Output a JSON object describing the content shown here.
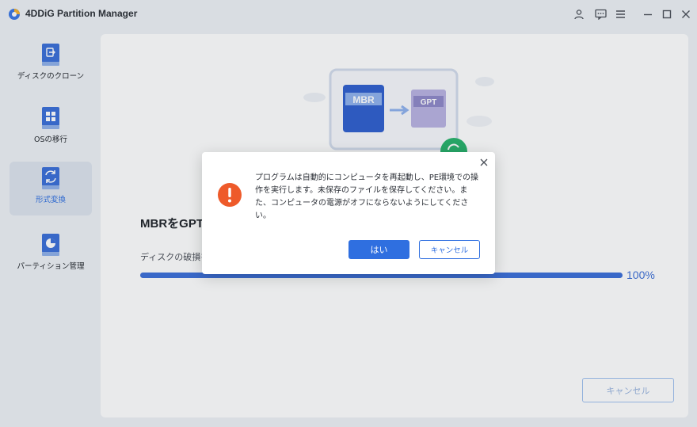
{
  "app": {
    "title": "4DDiG Partition Manager"
  },
  "sidebar": {
    "items": [
      {
        "label": "ディスクのクローン",
        "icon": "disk-clone-icon"
      },
      {
        "label": "OSの移行",
        "icon": "os-migrate-icon"
      },
      {
        "label": "形式変換",
        "icon": "format-convert-icon",
        "active": true
      },
      {
        "label": "パーティション管理",
        "icon": "partition-manage-icon"
      }
    ]
  },
  "main": {
    "illustration": {
      "from": "MBR",
      "to": "GPT"
    },
    "heading": "MBRをGPT",
    "subtext": "ディスクの破損を",
    "progress": {
      "value": 100,
      "label": "100%"
    },
    "cancel_label": "キャンセル"
  },
  "dialog": {
    "message": "プログラムは自動的にコンピュータを再起動し、PE環境での操作を実行します。未保存のファイルを保存してください。また、コンピュータの電源がオフにならないようにしてください。",
    "yes_label": "はい",
    "cancel_label": "キャンセル"
  },
  "colors": {
    "accent": "#2f6fe0",
    "progress": "#3b6fd8",
    "warning": "#ee5a2a",
    "success": "#27b36b"
  }
}
